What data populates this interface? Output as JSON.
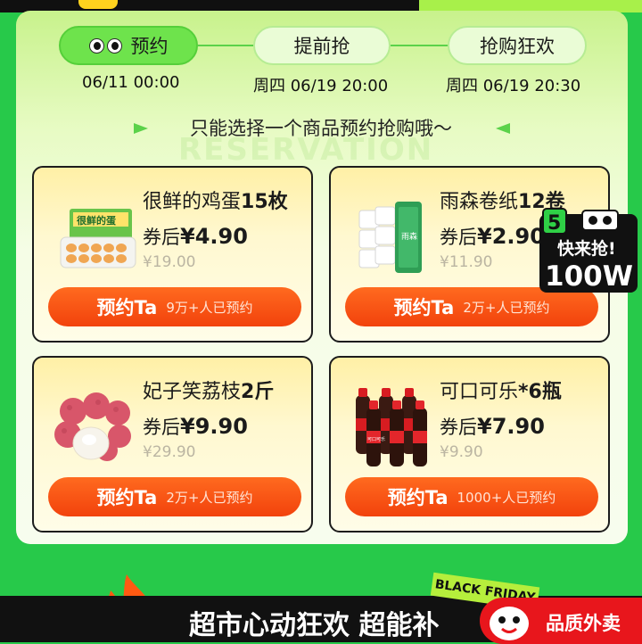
{
  "steps": [
    {
      "label": "预约",
      "time": "06/11 00:00"
    },
    {
      "label": "提前抢",
      "time": "周四 06/19 20:00"
    },
    {
      "label": "抢购狂欢",
      "time": "周四 06/19 20:30"
    }
  ],
  "subtitle": "只能选择一个商品预约抢购哦～",
  "watermark": "RESERVATION",
  "products": [
    {
      "name": "很鲜的鸡蛋",
      "qty": "15枚",
      "price_prefix": "券后",
      "price": "¥4.90",
      "original": "¥19.00",
      "button": "预约Ta",
      "count": "9万+人已预约",
      "package_text": "很鲜的蛋"
    },
    {
      "name": "雨森卷纸",
      "qty": "12卷",
      "price_prefix": "券后",
      "price": "¥2.90",
      "original": "¥11.90",
      "button": "预约Ta",
      "count": "2万+人已预约",
      "package_text": "雨森"
    },
    {
      "name": "妃子笑荔枝",
      "qty": "2斤",
      "price_prefix": "券后",
      "price": "¥9.90",
      "original": "¥29.90",
      "button": "预约Ta",
      "count": "2万+人已预约"
    },
    {
      "name": "可口可乐",
      "qty": "*6瓶",
      "price_prefix": "券后",
      "price": "¥7.90",
      "original": "¥9.90",
      "button": "预约Ta",
      "count": "1000+人已预约",
      "package_text": "可口可乐"
    }
  ],
  "badge": {
    "number": "5",
    "top": "快来抢!",
    "main": "100W"
  },
  "bottom": {
    "banner": "超市心动狂欢 超能补",
    "tag": "BLACK FRIDAY",
    "quality": "品质外卖"
  },
  "colors": {
    "accent_green": "#6ee34c",
    "button_orange": "#f2420c",
    "page_green": "#27c94a"
  }
}
